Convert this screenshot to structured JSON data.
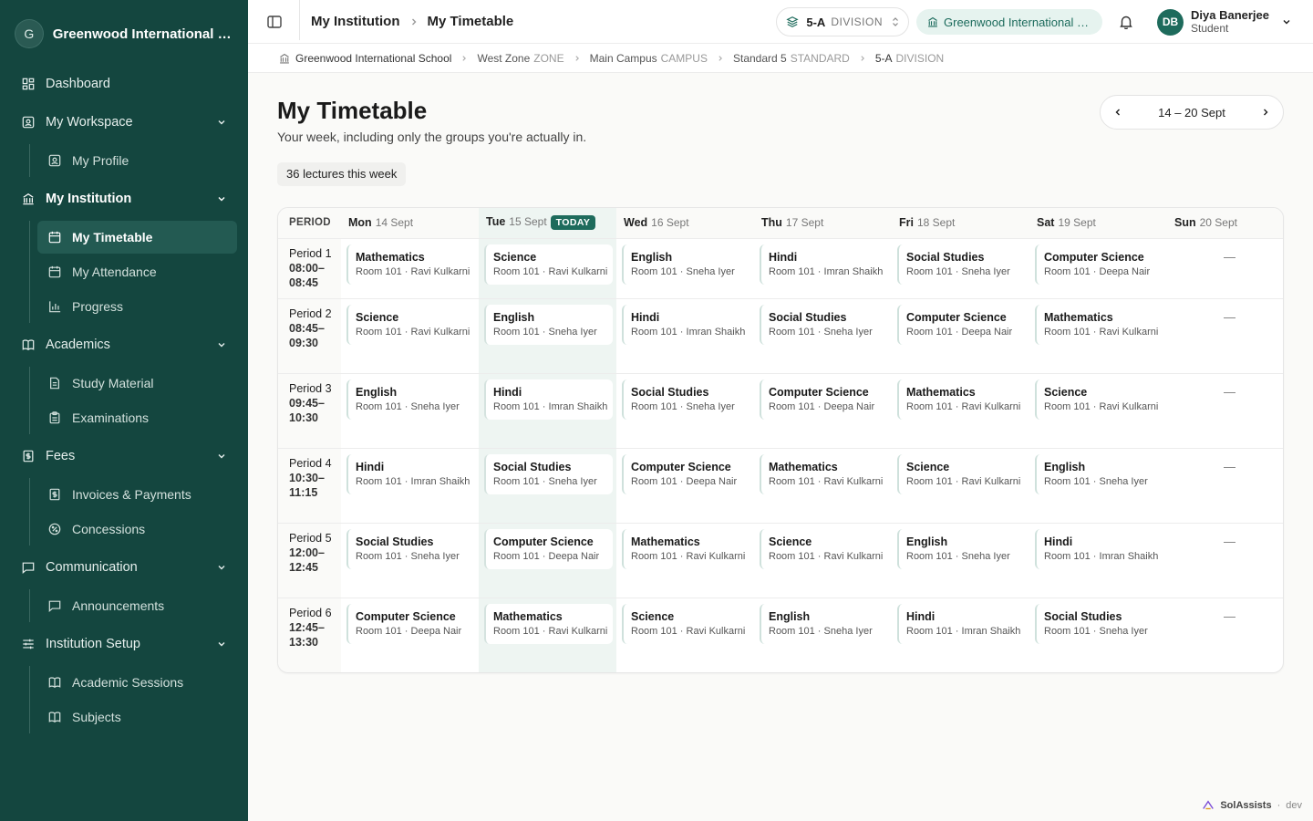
{
  "org": {
    "initial": "G",
    "name": "Greenwood International Sc..."
  },
  "nav": {
    "dashboard": "Dashboard",
    "workspace": "My Workspace",
    "profile": "My Profile",
    "institution": "My Institution",
    "timetable": "My Timetable",
    "attendance": "My Attendance",
    "progress": "Progress",
    "academics": "Academics",
    "study_material": "Study Material",
    "examinations": "Examinations",
    "fees": "Fees",
    "invoices": "Invoices & Payments",
    "concessions": "Concessions",
    "communication": "Communication",
    "announcements": "Announcements",
    "setup": "Institution Setup",
    "sessions": "Academic Sessions",
    "subjects": "Subjects"
  },
  "topbar": {
    "crumb1": "My Institution",
    "crumb2": "My Timetable",
    "division_value": "5-A",
    "division_tag": "DIVISION",
    "school": "Greenwood International S...",
    "user_initials": "DB",
    "user_name": "Diya Banerjee",
    "user_role": "Student"
  },
  "breadcrumb": {
    "school": "Greenwood International School",
    "zone": "West Zone",
    "zone_tag": "ZONE",
    "campus": "Main Campus",
    "campus_tag": "CAMPUS",
    "standard": "Standard 5",
    "standard_tag": "STANDARD",
    "division": "5-A",
    "division_tag": "DIVISION"
  },
  "page": {
    "title": "My Timetable",
    "subtitle": "Your week, including only the groups you're actually in.",
    "count": "36 lectures this week",
    "week": "14 – 20 Sept"
  },
  "timetable": {
    "period_header": "PERIOD",
    "today_badge": "TODAY",
    "days": [
      {
        "d": "Mon",
        "date": "14 Sept"
      },
      {
        "d": "Tue",
        "date": "15 Sept"
      },
      {
        "d": "Wed",
        "date": "16 Sept"
      },
      {
        "d": "Thu",
        "date": "17 Sept"
      },
      {
        "d": "Fri",
        "date": "18 Sept"
      },
      {
        "d": "Sat",
        "date": "19 Sept"
      },
      {
        "d": "Sun",
        "date": "20 Sept"
      }
    ],
    "empty": "—",
    "periods": [
      {
        "label": "Period 1",
        "time": "08:00–08:45",
        "cells": [
          {
            "s": "Mathematics",
            "r": "Room 101 · Ravi Kulkarni"
          },
          {
            "s": "Science",
            "r": "Room 101 · Ravi Kulkarni"
          },
          {
            "s": "English",
            "r": "Room 101 · Sneha Iyer"
          },
          {
            "s": "Hindi",
            "r": "Room 101 · Imran Shaikh"
          },
          {
            "s": "Social Studies",
            "r": "Room 101 · Sneha Iyer"
          },
          {
            "s": "Computer Science",
            "r": "Room 101 · Deepa Nair"
          }
        ]
      },
      {
        "label": "Period 2",
        "time": "08:45–09:30",
        "cells": [
          {
            "s": "Science",
            "r": "Room 101 · Ravi Kulkarni"
          },
          {
            "s": "English",
            "r": "Room 101 · Sneha Iyer"
          },
          {
            "s": "Hindi",
            "r": "Room 101 · Imran Shaikh"
          },
          {
            "s": "Social Studies",
            "r": "Room 101 · Sneha Iyer"
          },
          {
            "s": "Computer Science",
            "r": "Room 101 · Deepa Nair"
          },
          {
            "s": "Mathematics",
            "r": "Room 101 · Ravi Kulkarni"
          }
        ]
      },
      {
        "label": "Period 3",
        "time": "09:45–10:30",
        "cells": [
          {
            "s": "English",
            "r": "Room 101 · Sneha Iyer"
          },
          {
            "s": "Hindi",
            "r": "Room 101 · Imran Shaikh"
          },
          {
            "s": "Social Studies",
            "r": "Room 101 · Sneha Iyer"
          },
          {
            "s": "Computer Science",
            "r": "Room 101 · Deepa Nair"
          },
          {
            "s": "Mathematics",
            "r": "Room 101 · Ravi Kulkarni"
          },
          {
            "s": "Science",
            "r": "Room 101 · Ravi Kulkarni"
          }
        ]
      },
      {
        "label": "Period 4",
        "time": "10:30–11:15",
        "cells": [
          {
            "s": "Hindi",
            "r": "Room 101 · Imran Shaikh"
          },
          {
            "s": "Social Studies",
            "r": "Room 101 · Sneha Iyer"
          },
          {
            "s": "Computer Science",
            "r": "Room 101 · Deepa Nair"
          },
          {
            "s": "Mathematics",
            "r": "Room 101 · Ravi Kulkarni"
          },
          {
            "s": "Science",
            "r": "Room 101 · Ravi Kulkarni"
          },
          {
            "s": "English",
            "r": "Room 101 · Sneha Iyer"
          }
        ]
      },
      {
        "label": "Period 5",
        "time": "12:00–12:45",
        "cells": [
          {
            "s": "Social Studies",
            "r": "Room 101 · Sneha Iyer"
          },
          {
            "s": "Computer Science",
            "r": "Room 101 · Deepa Nair"
          },
          {
            "s": "Mathematics",
            "r": "Room 101 · Ravi Kulkarni"
          },
          {
            "s": "Science",
            "r": "Room 101 · Ravi Kulkarni"
          },
          {
            "s": "English",
            "r": "Room 101 · Sneha Iyer"
          },
          {
            "s": "Hindi",
            "r": "Room 101 · Imran Shaikh"
          }
        ]
      },
      {
        "label": "Period 6",
        "time": "12:45–13:30",
        "cells": [
          {
            "s": "Computer Science",
            "r": "Room 101 · Deepa Nair"
          },
          {
            "s": "Mathematics",
            "r": "Room 101 · Ravi Kulkarni"
          },
          {
            "s": "Science",
            "r": "Room 101 · Ravi Kulkarni"
          },
          {
            "s": "English",
            "r": "Room 101 · Sneha Iyer"
          },
          {
            "s": "Hindi",
            "r": "Room 101 · Imran Shaikh"
          },
          {
            "s": "Social Studies",
            "r": "Room 101 · Sneha Iyer"
          }
        ]
      }
    ]
  },
  "footer": {
    "brand": "SolAssists",
    "sep": "·",
    "env": "dev"
  },
  "colors": {
    "sidebar": "#14463f",
    "accent": "#1e6b5c",
    "today": "#eef5f2"
  }
}
